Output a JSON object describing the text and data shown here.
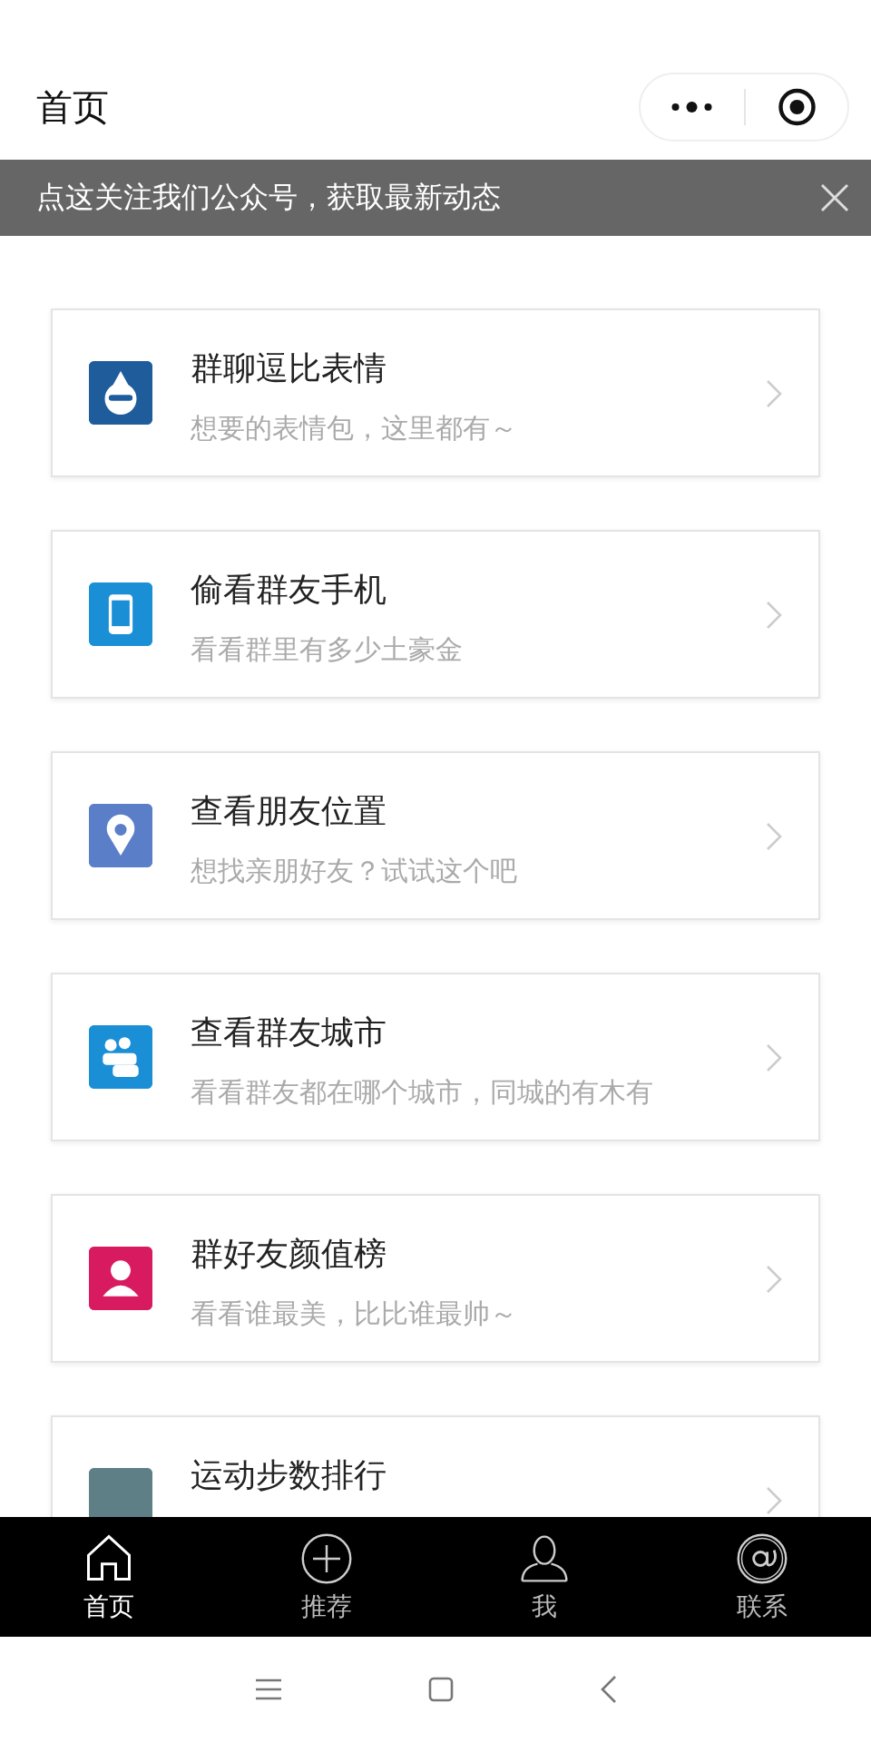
{
  "header": {
    "title": "首页"
  },
  "banner": {
    "text": "点这关注我们公众号，获取最新动态"
  },
  "cards": [
    {
      "kind": "drop",
      "color": "#1e5c9c",
      "title": "群聊逗比表情",
      "subtitle": "想要的表情包，这里都有～"
    },
    {
      "kind": "phone",
      "color": "#1a8fd6",
      "title": "偷看群友手机",
      "subtitle": "看看群里有多少土豪金"
    },
    {
      "kind": "pin",
      "color": "#5a7fc8",
      "title": "查看朋友位置",
      "subtitle": "想找亲朋好友？试试这个吧"
    },
    {
      "kind": "group",
      "color": "#1a8fd6",
      "title": "查看群友城市",
      "subtitle": "看看群友都在哪个城市，同城的有木有"
    },
    {
      "kind": "person",
      "color": "#d81b60",
      "title": "群好友颜值榜",
      "subtitle": "看看谁最美，比比谁最帅～"
    },
    {
      "kind": "steps",
      "color": "#5f7f86",
      "title": "运动步数排行"
    }
  ],
  "tab_bar": [
    {
      "kind": "home",
      "label": "首页",
      "selected": true
    },
    {
      "kind": "plus",
      "label": "推荐",
      "selected": false
    },
    {
      "kind": "user",
      "label": "我",
      "selected": false
    },
    {
      "kind": "at",
      "label": "联系",
      "selected": false
    }
  ]
}
